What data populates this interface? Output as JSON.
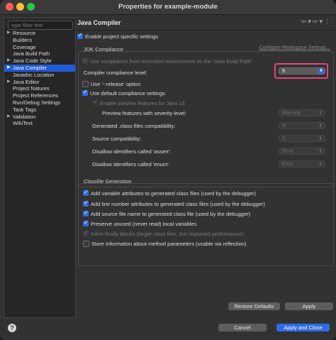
{
  "window": {
    "title": "Properties for example-module"
  },
  "sidebar": {
    "filter_placeholder": "type filter text",
    "items": [
      {
        "label": "Resource",
        "expandable": true
      },
      {
        "label": "Builders",
        "expandable": false
      },
      {
        "label": "Coverage",
        "expandable": false
      },
      {
        "label": "Java Build Path",
        "expandable": false
      },
      {
        "label": "Java Code Style",
        "expandable": true
      },
      {
        "label": "Java Compiler",
        "expandable": true,
        "selected": true
      },
      {
        "label": "Javadoc Location",
        "expandable": false
      },
      {
        "label": "Java Editor",
        "expandable": true
      },
      {
        "label": "Project Natures",
        "expandable": false
      },
      {
        "label": "Project References",
        "expandable": false
      },
      {
        "label": "Run/Debug Settings",
        "expandable": false
      },
      {
        "label": "Task Tags",
        "expandable": false
      },
      {
        "label": "Validation",
        "expandable": true
      },
      {
        "label": "WikiText",
        "expandable": false
      }
    ]
  },
  "page": {
    "title": "Java Compiler",
    "enable_project_settings": "Enable project specific settings",
    "configure_workspace_link": "Configure Workspace Settings...",
    "jdk_group_label": "JDK Compliance",
    "use_compliance_env": "Use compliance from execution environment on the 'Java Build Path'",
    "compliance_level_label": "Compiler compliance level:",
    "compliance_level_value": "9",
    "release_option": "Use '--release' option",
    "default_compliance": "Use default compliance settings",
    "enable_preview": "Enable preview features for Java 16",
    "preview_severity_label": "Preview features with severity level:",
    "preview_severity_value": "Warning",
    "class_compat_label": "Generated .class files compatibility:",
    "class_compat_value": "9",
    "source_compat_label": "Source compatibility:",
    "source_compat_value": "9",
    "assert_label": "Disallow identifiers called 'assert':",
    "assert_value": "Error",
    "enum_label": "Disallow identifiers called 'enum':",
    "enum_value": "Error",
    "classfile_group_label": "Classfile Generation",
    "cf_variable": "Add variable attributes to generated class files (used by the debugger)",
    "cf_line": "Add line number attributes to generated class files (used by the debugger)",
    "cf_source": "Add source file name to generated class file (used by the debugger)",
    "cf_preserve": "Preserve unused (never read) local variables",
    "cf_inline": "Inline finally blocks (larger class files, but improved performance)",
    "cf_store_params": "Store information about method parameters (usable via reflection)"
  },
  "buttons": {
    "restore_defaults": "Restore Defaults",
    "apply": "Apply",
    "cancel": "Cancel",
    "apply_and_close": "Apply and Close",
    "help": "?"
  },
  "colors": {
    "accent": "#2f6be6",
    "highlight": "#e5457a",
    "selection": "#1e5bd6"
  }
}
